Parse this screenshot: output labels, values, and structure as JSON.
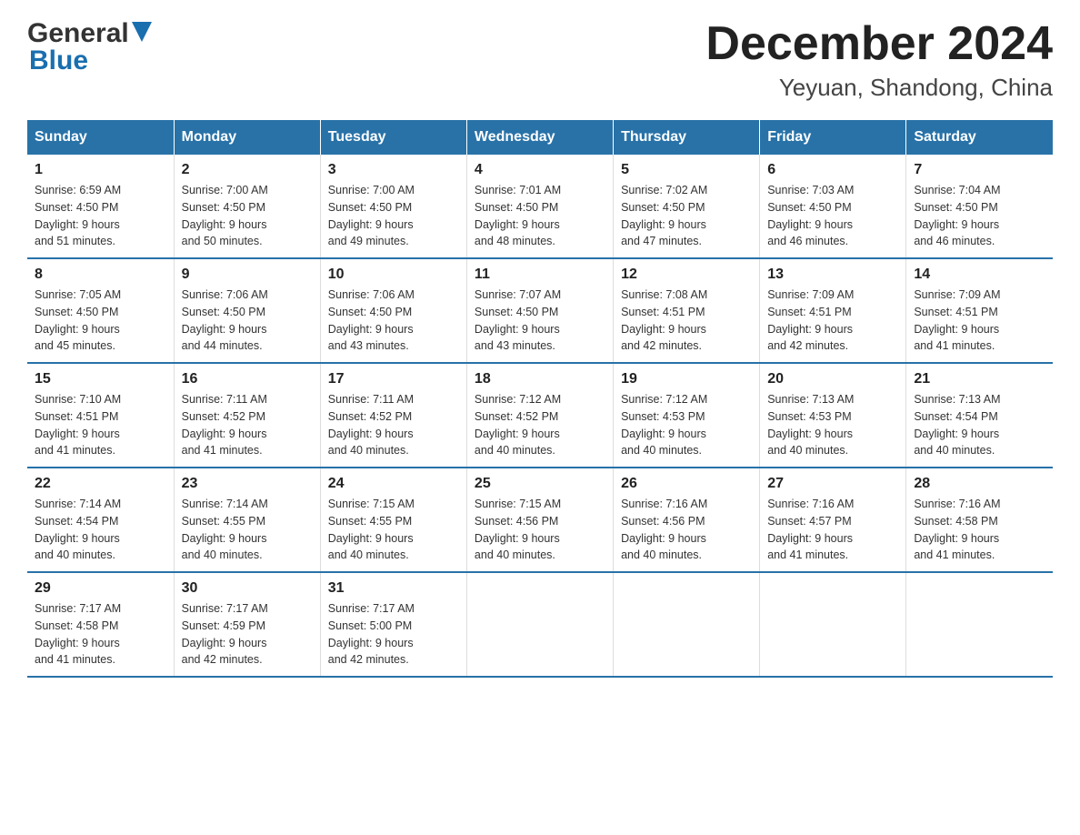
{
  "header": {
    "logo_general": "General",
    "logo_blue": "Blue",
    "title": "December 2024",
    "subtitle": "Yeyuan, Shandong, China"
  },
  "columns": [
    "Sunday",
    "Monday",
    "Tuesday",
    "Wednesday",
    "Thursday",
    "Friday",
    "Saturday"
  ],
  "weeks": [
    [
      {
        "day": "1",
        "info": "Sunrise: 6:59 AM\nSunset: 4:50 PM\nDaylight: 9 hours\nand 51 minutes."
      },
      {
        "day": "2",
        "info": "Sunrise: 7:00 AM\nSunset: 4:50 PM\nDaylight: 9 hours\nand 50 minutes."
      },
      {
        "day": "3",
        "info": "Sunrise: 7:00 AM\nSunset: 4:50 PM\nDaylight: 9 hours\nand 49 minutes."
      },
      {
        "day": "4",
        "info": "Sunrise: 7:01 AM\nSunset: 4:50 PM\nDaylight: 9 hours\nand 48 minutes."
      },
      {
        "day": "5",
        "info": "Sunrise: 7:02 AM\nSunset: 4:50 PM\nDaylight: 9 hours\nand 47 minutes."
      },
      {
        "day": "6",
        "info": "Sunrise: 7:03 AM\nSunset: 4:50 PM\nDaylight: 9 hours\nand 46 minutes."
      },
      {
        "day": "7",
        "info": "Sunrise: 7:04 AM\nSunset: 4:50 PM\nDaylight: 9 hours\nand 46 minutes."
      }
    ],
    [
      {
        "day": "8",
        "info": "Sunrise: 7:05 AM\nSunset: 4:50 PM\nDaylight: 9 hours\nand 45 minutes."
      },
      {
        "day": "9",
        "info": "Sunrise: 7:06 AM\nSunset: 4:50 PM\nDaylight: 9 hours\nand 44 minutes."
      },
      {
        "day": "10",
        "info": "Sunrise: 7:06 AM\nSunset: 4:50 PM\nDaylight: 9 hours\nand 43 minutes."
      },
      {
        "day": "11",
        "info": "Sunrise: 7:07 AM\nSunset: 4:50 PM\nDaylight: 9 hours\nand 43 minutes."
      },
      {
        "day": "12",
        "info": "Sunrise: 7:08 AM\nSunset: 4:51 PM\nDaylight: 9 hours\nand 42 minutes."
      },
      {
        "day": "13",
        "info": "Sunrise: 7:09 AM\nSunset: 4:51 PM\nDaylight: 9 hours\nand 42 minutes."
      },
      {
        "day": "14",
        "info": "Sunrise: 7:09 AM\nSunset: 4:51 PM\nDaylight: 9 hours\nand 41 minutes."
      }
    ],
    [
      {
        "day": "15",
        "info": "Sunrise: 7:10 AM\nSunset: 4:51 PM\nDaylight: 9 hours\nand 41 minutes."
      },
      {
        "day": "16",
        "info": "Sunrise: 7:11 AM\nSunset: 4:52 PM\nDaylight: 9 hours\nand 41 minutes."
      },
      {
        "day": "17",
        "info": "Sunrise: 7:11 AM\nSunset: 4:52 PM\nDaylight: 9 hours\nand 40 minutes."
      },
      {
        "day": "18",
        "info": "Sunrise: 7:12 AM\nSunset: 4:52 PM\nDaylight: 9 hours\nand 40 minutes."
      },
      {
        "day": "19",
        "info": "Sunrise: 7:12 AM\nSunset: 4:53 PM\nDaylight: 9 hours\nand 40 minutes."
      },
      {
        "day": "20",
        "info": "Sunrise: 7:13 AM\nSunset: 4:53 PM\nDaylight: 9 hours\nand 40 minutes."
      },
      {
        "day": "21",
        "info": "Sunrise: 7:13 AM\nSunset: 4:54 PM\nDaylight: 9 hours\nand 40 minutes."
      }
    ],
    [
      {
        "day": "22",
        "info": "Sunrise: 7:14 AM\nSunset: 4:54 PM\nDaylight: 9 hours\nand 40 minutes."
      },
      {
        "day": "23",
        "info": "Sunrise: 7:14 AM\nSunset: 4:55 PM\nDaylight: 9 hours\nand 40 minutes."
      },
      {
        "day": "24",
        "info": "Sunrise: 7:15 AM\nSunset: 4:55 PM\nDaylight: 9 hours\nand 40 minutes."
      },
      {
        "day": "25",
        "info": "Sunrise: 7:15 AM\nSunset: 4:56 PM\nDaylight: 9 hours\nand 40 minutes."
      },
      {
        "day": "26",
        "info": "Sunrise: 7:16 AM\nSunset: 4:56 PM\nDaylight: 9 hours\nand 40 minutes."
      },
      {
        "day": "27",
        "info": "Sunrise: 7:16 AM\nSunset: 4:57 PM\nDaylight: 9 hours\nand 41 minutes."
      },
      {
        "day": "28",
        "info": "Sunrise: 7:16 AM\nSunset: 4:58 PM\nDaylight: 9 hours\nand 41 minutes."
      }
    ],
    [
      {
        "day": "29",
        "info": "Sunrise: 7:17 AM\nSunset: 4:58 PM\nDaylight: 9 hours\nand 41 minutes."
      },
      {
        "day": "30",
        "info": "Sunrise: 7:17 AM\nSunset: 4:59 PM\nDaylight: 9 hours\nand 42 minutes."
      },
      {
        "day": "31",
        "info": "Sunrise: 7:17 AM\nSunset: 5:00 PM\nDaylight: 9 hours\nand 42 minutes."
      },
      {
        "day": "",
        "info": ""
      },
      {
        "day": "",
        "info": ""
      },
      {
        "day": "",
        "info": ""
      },
      {
        "day": "",
        "info": ""
      }
    ]
  ]
}
